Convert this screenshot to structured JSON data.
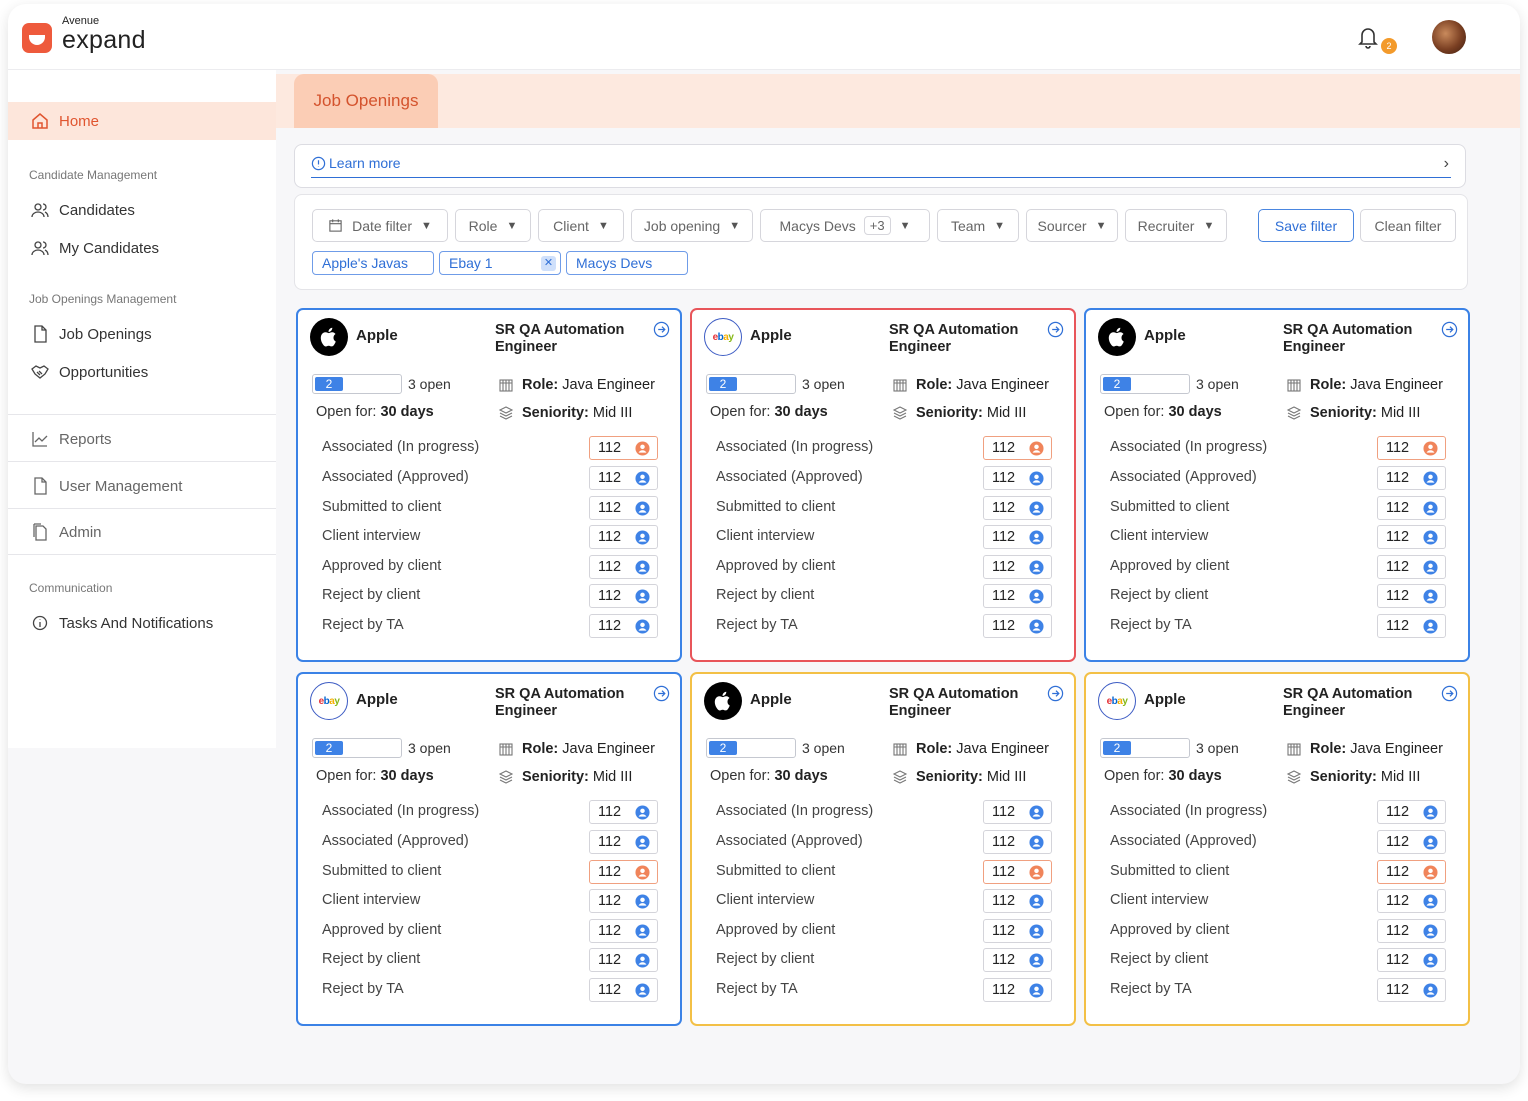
{
  "brand": {
    "small": "Avenue",
    "big": "expand"
  },
  "header": {
    "notification_count": "2"
  },
  "sidebar": {
    "home": "Home",
    "sections": {
      "candidate": "Candidate Management",
      "jobs": "Job Openings Management",
      "comm": "Communication"
    },
    "items": {
      "candidates": "Candidates",
      "my_candidates": "My Candidates",
      "job_openings": "Job Openings",
      "opportunities": "Opportunities",
      "reports": "Reports",
      "user_management": "User Management",
      "admin": "Admin",
      "tasks": "Tasks And Notifications"
    }
  },
  "tabs": {
    "active": "Job Openings"
  },
  "learn_more": "Learn more",
  "filters": {
    "date": "Date filter",
    "role": "Role",
    "client": "Client",
    "job_opening": "Job opening",
    "macys": "Macys Devs",
    "more": "+3",
    "team": "Team",
    "sourcer": "Sourcer",
    "recruiter": "Recruiter",
    "save": "Save filter",
    "clean": "Clean filter",
    "tags": [
      "Apple's Javas",
      "Ebay 1",
      "Macys Devs"
    ]
  },
  "colors": {
    "blue": "#3b82e6",
    "red": "#e8555a",
    "yellow": "#f3c046",
    "accent": "#e0552f"
  },
  "card_common": {
    "company": "Apple",
    "title": "SR QA Automation Engineer",
    "progress_value": "2",
    "open": "3 open",
    "open_for_label": "Open for:",
    "open_for_value": "30 days",
    "role_label": "Role:",
    "role_value": "Java Engineer",
    "seniority_label": "Seniority:",
    "seniority_value": "Mid III",
    "stat_labels": [
      "Associated  (In progress)",
      "Associated (Approved)",
      "Submitted to client",
      "Client interview",
      "Approved by client",
      "Reject by client",
      "Reject by TA"
    ],
    "stat_value": "112"
  },
  "cards": [
    {
      "logo": "apple",
      "border": "blue",
      "highlight": 0
    },
    {
      "logo": "ebay",
      "border": "red",
      "highlight": 0
    },
    {
      "logo": "apple",
      "border": "blue",
      "highlight": 0
    },
    {
      "logo": "ebay",
      "border": "blue",
      "highlight": 2
    },
    {
      "logo": "apple",
      "border": "yellow",
      "highlight": 2
    },
    {
      "logo": "ebay",
      "border": "yellow",
      "highlight": 2
    }
  ]
}
